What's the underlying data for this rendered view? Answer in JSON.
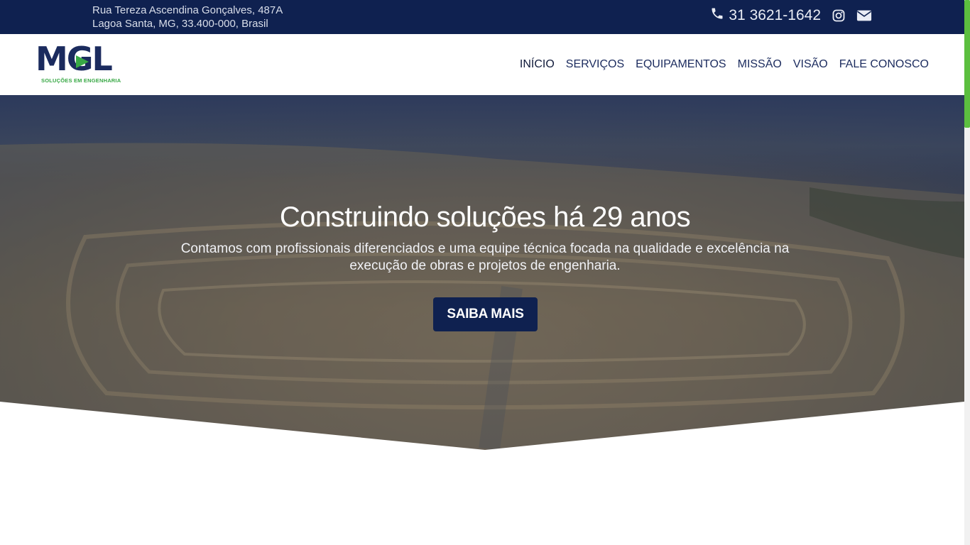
{
  "topbar": {
    "address_line1": "Rua Tereza Ascendina Gonçalves, 487A",
    "address_line2": "Lagoa Santa, MG, 33.400-000, Brasil",
    "phone": "31 3621-1642",
    "icons": [
      "phone-icon",
      "instagram-icon",
      "envelope-icon"
    ]
  },
  "logo": {
    "mark": "MGL",
    "tagline": "SOLUÇÕES EM ENGENHARIA"
  },
  "nav": {
    "items": [
      {
        "label": "INÍCIO"
      },
      {
        "label": "SERVIÇOS"
      },
      {
        "label": "EQUIPAMENTOS"
      },
      {
        "label": "MISSÃO"
      },
      {
        "label": "VISÃO"
      },
      {
        "label": "FALE CONOSCO"
      }
    ]
  },
  "hero": {
    "title": "Construindo soluções há 29 anos",
    "subtitle": "Contamos com profissionais diferenciados e uma equipe técnica focada na qualidade e excelência na execução de obras e projetos de engenharia.",
    "cta_label": "SAIBA MAIS"
  },
  "colors": {
    "navy": "#0f2150",
    "brand_blue": "#1b2b5e",
    "brand_green": "#38a845",
    "scroll_green": "#5cbf3f"
  }
}
